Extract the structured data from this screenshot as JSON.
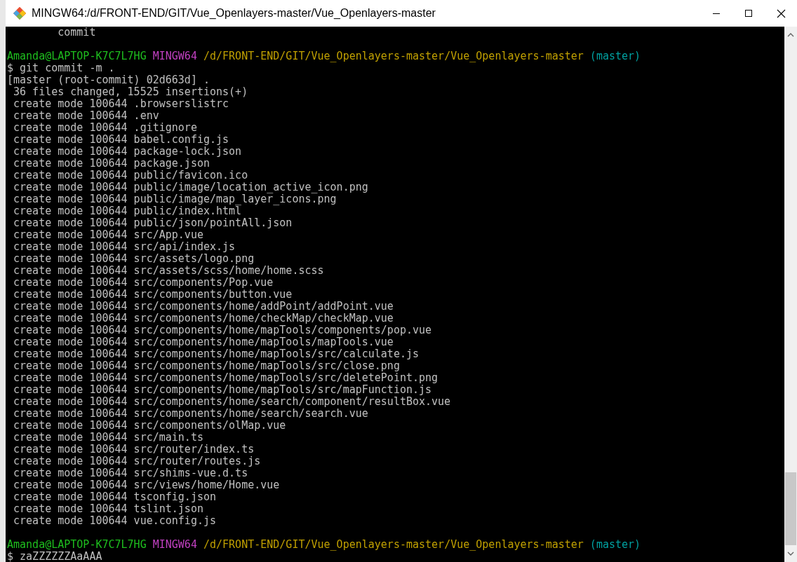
{
  "window": {
    "title": "MINGW64:/d/FRONT-END/GIT/Vue_Openlayers-master/Vue_Openlayers-master"
  },
  "terminal": {
    "lines": [
      {
        "kind": "output",
        "text": "        commit"
      },
      {
        "kind": "blank"
      },
      {
        "kind": "prompt",
        "user": "Amanda@LAPTOP-K7C7L7HG",
        "shell": "MINGW64",
        "path": "/d/FRONT-END/GIT/Vue_Openlayers-master/Vue_Openlayers-master",
        "branch": "(master)"
      },
      {
        "kind": "command",
        "text": "$ git commit -m ."
      },
      {
        "kind": "output",
        "text": "[master (root-commit) 02d663d] ."
      },
      {
        "kind": "output",
        "text": " 36 files changed, 15525 insertions(+)"
      },
      {
        "kind": "output",
        "text": " create mode 100644 .browserslistrc"
      },
      {
        "kind": "output",
        "text": " create mode 100644 .env"
      },
      {
        "kind": "output",
        "text": " create mode 100644 .gitignore"
      },
      {
        "kind": "output",
        "text": " create mode 100644 babel.config.js"
      },
      {
        "kind": "output",
        "text": " create mode 100644 package-lock.json"
      },
      {
        "kind": "output",
        "text": " create mode 100644 package.json"
      },
      {
        "kind": "output",
        "text": " create mode 100644 public/favicon.ico"
      },
      {
        "kind": "output",
        "text": " create mode 100644 public/image/location_active_icon.png"
      },
      {
        "kind": "output",
        "text": " create mode 100644 public/image/map_layer_icons.png"
      },
      {
        "kind": "output",
        "text": " create mode 100644 public/index.html"
      },
      {
        "kind": "output",
        "text": " create mode 100644 public/json/pointAll.json"
      },
      {
        "kind": "output",
        "text": " create mode 100644 src/App.vue"
      },
      {
        "kind": "output",
        "text": " create mode 100644 src/api/index.js"
      },
      {
        "kind": "output",
        "text": " create mode 100644 src/assets/logo.png"
      },
      {
        "kind": "output",
        "text": " create mode 100644 src/assets/scss/home/home.scss"
      },
      {
        "kind": "output",
        "text": " create mode 100644 src/components/Pop.vue"
      },
      {
        "kind": "output",
        "text": " create mode 100644 src/components/button.vue"
      },
      {
        "kind": "output",
        "text": " create mode 100644 src/components/home/addPoint/addPoint.vue"
      },
      {
        "kind": "output",
        "text": " create mode 100644 src/components/home/checkMap/checkMap.vue"
      },
      {
        "kind": "output",
        "text": " create mode 100644 src/components/home/mapTools/components/pop.vue"
      },
      {
        "kind": "output",
        "text": " create mode 100644 src/components/home/mapTools/mapTools.vue"
      },
      {
        "kind": "output",
        "text": " create mode 100644 src/components/home/mapTools/src/calculate.js"
      },
      {
        "kind": "output",
        "text": " create mode 100644 src/components/home/mapTools/src/close.png"
      },
      {
        "kind": "output",
        "text": " create mode 100644 src/components/home/mapTools/src/deletePoint.png"
      },
      {
        "kind": "output",
        "text": " create mode 100644 src/components/home/mapTools/src/mapFunction.js"
      },
      {
        "kind": "output",
        "text": " create mode 100644 src/components/home/search/component/resultBox.vue"
      },
      {
        "kind": "output",
        "text": " create mode 100644 src/components/home/search/search.vue"
      },
      {
        "kind": "output",
        "text": " create mode 100644 src/components/olMap.vue"
      },
      {
        "kind": "output",
        "text": " create mode 100644 src/main.ts"
      },
      {
        "kind": "output",
        "text": " create mode 100644 src/router/index.ts"
      },
      {
        "kind": "output",
        "text": " create mode 100644 src/router/routes.js"
      },
      {
        "kind": "output",
        "text": " create mode 100644 src/shims-vue.d.ts"
      },
      {
        "kind": "output",
        "text": " create mode 100644 src/views/home/Home.vue"
      },
      {
        "kind": "output",
        "text": " create mode 100644 tsconfig.json"
      },
      {
        "kind": "output",
        "text": " create mode 100644 tslint.json"
      },
      {
        "kind": "output",
        "text": " create mode 100644 vue.config.js"
      },
      {
        "kind": "blank"
      },
      {
        "kind": "prompt",
        "user": "Amanda@LAPTOP-K7C7L7HG",
        "shell": "MINGW64",
        "path": "/d/FRONT-END/GIT/Vue_Openlayers-master/Vue_Openlayers-master",
        "branch": "(master)"
      },
      {
        "kind": "command",
        "text": "$ zaZZZZZZAaAAA"
      }
    ]
  }
}
